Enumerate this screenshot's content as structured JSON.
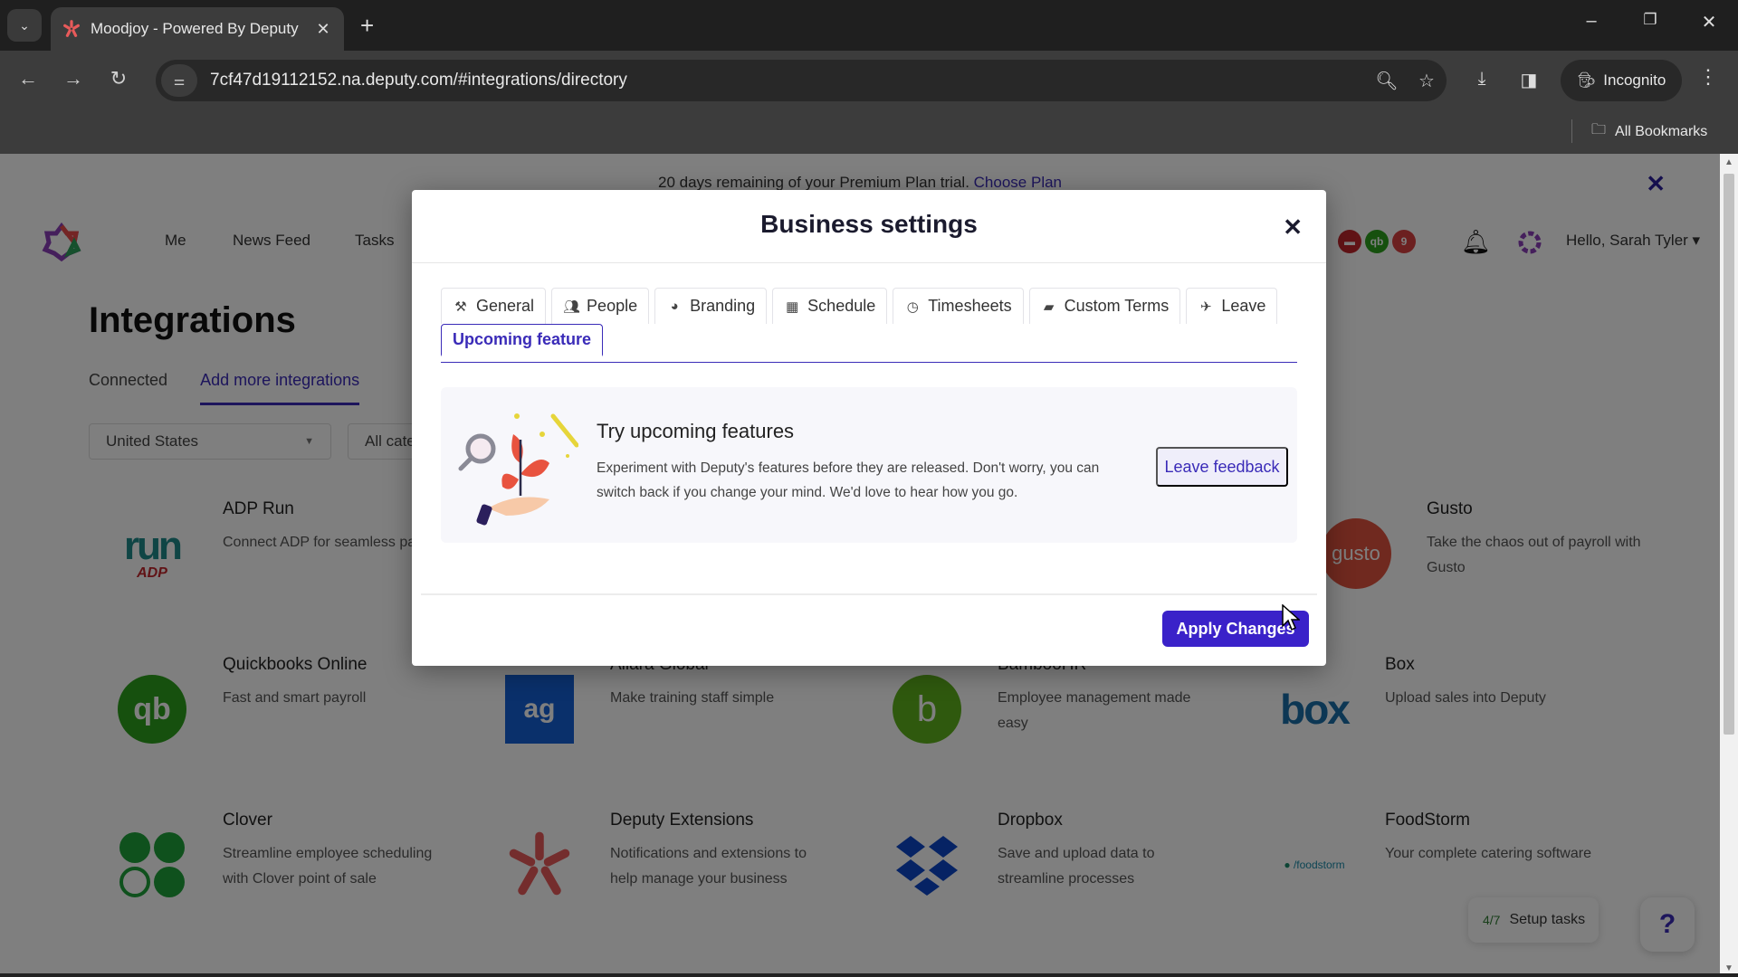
{
  "browser": {
    "tab_title": "Moodjoy - Powered By Deputy",
    "url": "7cf47d19112152.na.deputy.com/#integrations/directory",
    "incognito_label": "Incognito",
    "bookmarks_label": "All Bookmarks"
  },
  "banner": {
    "text": "20 days remaining of your Premium Plan trial.",
    "link": "Choose Plan"
  },
  "topnav": {
    "links": [
      "Me",
      "News Feed",
      "Tasks"
    ],
    "badges": [
      {
        "label": "",
        "color": "#c2272d"
      },
      {
        "label": "qb",
        "color": "#2ca01c"
      },
      {
        "label": "9",
        "color": "#d84040"
      }
    ],
    "greeting": "Hello, Sarah Tyler"
  },
  "page": {
    "title": "Integrations",
    "tabs": [
      {
        "label": "Connected",
        "active": false
      },
      {
        "label": "Add more integrations",
        "active": true
      }
    ],
    "filters": {
      "country": "United States",
      "category": "All categories"
    }
  },
  "integrations": [
    {
      "name": "ADP Run",
      "desc": "Connect ADP for seamless payroll",
      "logo": "adp-run"
    },
    {
      "name": "Gusto",
      "desc": "Take the chaos out of payroll with Gusto",
      "logo": "gusto"
    },
    {
      "name": "Quickbooks Online",
      "desc": "Fast and smart payroll",
      "logo": "quickbooks"
    },
    {
      "name": "Allara Global",
      "desc": "Make training staff simple",
      "logo": "allara"
    },
    {
      "name": "BambooHR",
      "desc": "Employee management made easy",
      "logo": "bamboohr"
    },
    {
      "name": "Box",
      "desc": "Upload sales into Deputy",
      "logo": "box"
    },
    {
      "name": "Clover",
      "desc": "Streamline employee scheduling with Clover point of sale",
      "logo": "clover"
    },
    {
      "name": "Deputy Extensions",
      "desc": "Notifications and extensions to help manage your business",
      "logo": "deputy"
    },
    {
      "name": "Dropbox",
      "desc": "Save and upload data to streamline processes",
      "logo": "dropbox"
    },
    {
      "name": "FoodStorm",
      "desc": "Your complete catering software",
      "logo": "foodstorm"
    }
  ],
  "setup_tasks": {
    "count": "4/7",
    "label": "Setup tasks"
  },
  "help_label": "?",
  "modal": {
    "title": "Business settings",
    "tabs": [
      {
        "label": "General",
        "icon": "tools-icon"
      },
      {
        "label": "People",
        "icon": "people-icon"
      },
      {
        "label": "Branding",
        "icon": "palette-icon"
      },
      {
        "label": "Schedule",
        "icon": "calendar-icon"
      },
      {
        "label": "Timesheets",
        "icon": "clock-icon"
      },
      {
        "label": "Custom Terms",
        "icon": "book-icon"
      },
      {
        "label": "Leave",
        "icon": "plane-icon"
      },
      {
        "label": "Upcoming feature",
        "icon": "",
        "active": true
      }
    ],
    "feature": {
      "title": "Try upcoming features",
      "description": "Experiment with Deputy's features before they are released. Don't worry, you can switch back if you change your mind. We'd love to hear how you go.",
      "feedback_label": "Leave feedback"
    },
    "apply_label": "Apply Changes"
  },
  "colors": {
    "accent": "#3a2bb8",
    "apply_button": "#3a22c9"
  }
}
